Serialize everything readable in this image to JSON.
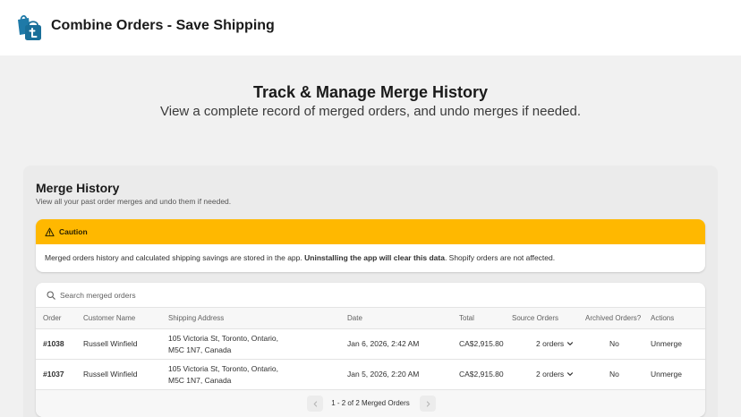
{
  "app": {
    "title": "Combine Orders - Save Shipping",
    "logo_icon": "shopping-bag-logo-icon",
    "logo_color": "#1f7aa8"
  },
  "hero": {
    "title": "Track & Manage Merge History",
    "subtitle": "View a complete record of merged orders, and undo merges if needed."
  },
  "panel": {
    "title": "Merge History",
    "subtitle": "View all your past order merges and undo them if needed."
  },
  "caution": {
    "title": "Caution",
    "color": "#ffb800",
    "text_before": "Merged orders history and calculated shipping savings are stored in the app. ",
    "text_bold": "Uninstalling the app will clear this data",
    "text_after": ". Shopify orders are not affected."
  },
  "search": {
    "placeholder": "Search merged orders",
    "value": ""
  },
  "table": {
    "headers": {
      "order": "Order",
      "customer": "Customer Name",
      "address": "Shipping Address",
      "date": "Date",
      "total": "Total",
      "source": "Source Orders",
      "archived": "Archived Orders?",
      "actions": "Actions"
    },
    "rows": [
      {
        "order": "#1038",
        "customer": "Russell Winfield",
        "address_line1": "105 Victoria St, Toronto, Ontario,",
        "address_line2": "M5C 1N7, Canada",
        "date": "Jan 6, 2026, 2:42 AM",
        "total": "CA$2,915.80",
        "source": "2 orders",
        "archived": "No",
        "action": "Unmerge"
      },
      {
        "order": "#1037",
        "customer": "Russell Winfield",
        "address_line1": "105 Victoria St, Toronto, Ontario,",
        "address_line2": "M5C 1N7, Canada",
        "date": "Jan 5, 2026, 2:20 AM",
        "total": "CA$2,915.80",
        "source": "2 orders",
        "archived": "No",
        "action": "Unmerge"
      }
    ]
  },
  "pagination": {
    "label": "1 - 2 of 2 Merged Orders",
    "prev_icon": "chevron-left-icon",
    "next_icon": "chevron-right-icon"
  }
}
